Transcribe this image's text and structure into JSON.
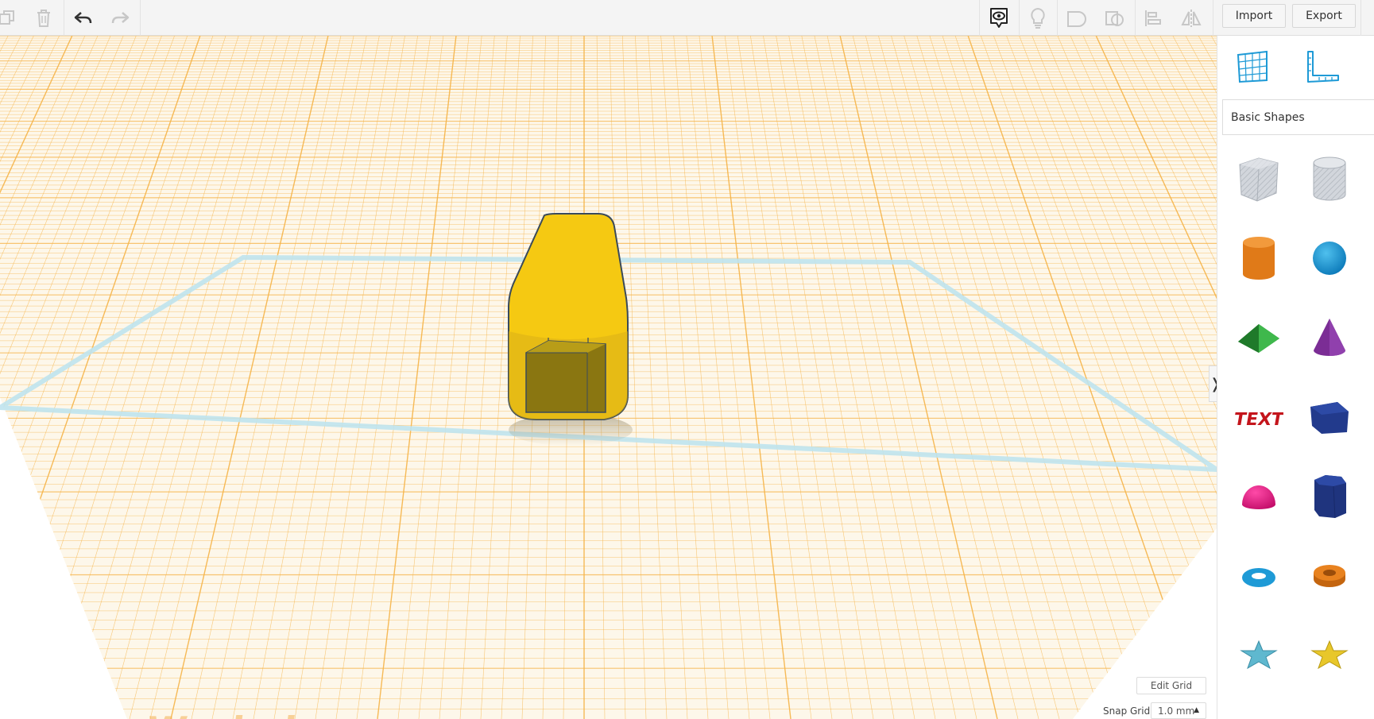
{
  "toolbar": {
    "import_label": "Import",
    "export_label": "Export",
    "left_icons": [
      "copy-icon",
      "trash-icon",
      "undo-icon",
      "redo-icon"
    ],
    "right_icons": [
      "notes-visibility-icon",
      "lightbulb-icon",
      "group-shape-icon",
      "ungroup-shape-icon",
      "align-icon",
      "mirror-icon"
    ]
  },
  "panel": {
    "tools": [
      "workplane-tool-icon",
      "ruler-tool-icon"
    ],
    "category_label": "Basic Shapes",
    "shapes": [
      {
        "name": "box-hole",
        "color": "#c8ccd2"
      },
      {
        "name": "cylinder-hole",
        "color": "#c8ccd2"
      },
      {
        "name": "cylinder",
        "color": "#e8821f"
      },
      {
        "name": "sphere",
        "color": "#1e9ad6"
      },
      {
        "name": "roof",
        "color": "#2ea03c"
      },
      {
        "name": "cone",
        "color": "#7b2d95"
      },
      {
        "name": "text",
        "color": "#c4151c"
      },
      {
        "name": "box",
        "color": "#223a8c"
      },
      {
        "name": "half-sphere",
        "color": "#e0127a"
      },
      {
        "name": "polygon",
        "color": "#243b8c"
      },
      {
        "name": "torus",
        "color": "#1e9ad6"
      },
      {
        "name": "tube",
        "color": "#e8821f"
      },
      {
        "name": "star",
        "color": "#5fb8cf"
      },
      {
        "name": "star-gold",
        "color": "#e8c72a"
      }
    ],
    "text_shape_label": "TEXT"
  },
  "viewport": {
    "workplane_label": "Workplane",
    "edit_grid_label": "Edit Grid",
    "snap_grid_label": "Snap Grid",
    "snap_grid_value": "1.0 mm",
    "selected_shape_color": "#f5c912",
    "inner_box_color": "#8a7611",
    "grid_color": "#f5b347"
  }
}
